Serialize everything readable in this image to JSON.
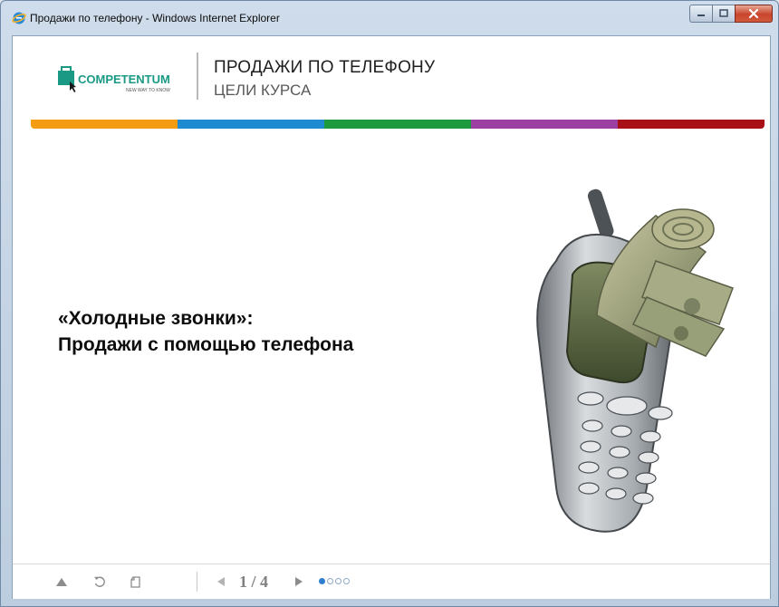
{
  "window": {
    "title": "Продажи по телефону - Windows Internet Explorer",
    "app_icon": "ie-icon"
  },
  "header": {
    "logo_text": "COMPETENTUM",
    "logo_tagline": "NEW WAY TO KNOW",
    "course_title": "ПРОДАЖИ ПО ТЕЛЕФОНУ",
    "course_subtitle": "ЦЕЛИ КУРСА",
    "stripe_colors": [
      "#f39c12",
      "#1e8bd1",
      "#1d9a3d",
      "#9b3fa0",
      "#a80f17"
    ]
  },
  "slide": {
    "heading_line1": "«Холодные звонки»:",
    "heading_line2": "Продажи с помощью телефона",
    "illustration": "phone-with-money"
  },
  "toolbar": {
    "up_icon": "triangle-up-icon",
    "refresh_icon": "refresh-icon",
    "print_icon": "print-icon",
    "page_label": "1 / 4",
    "current_page": 1,
    "total_pages": 4,
    "accent_color": "#2f7fd0"
  }
}
